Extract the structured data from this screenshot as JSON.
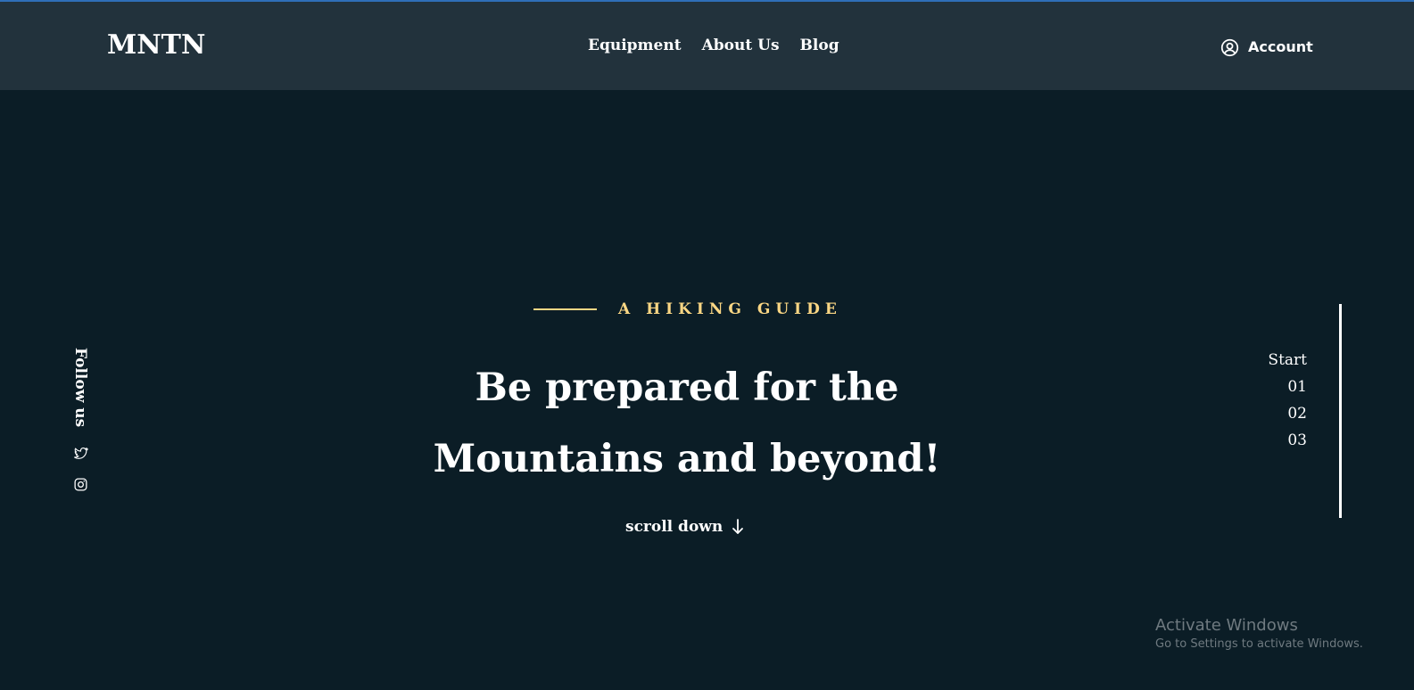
{
  "header": {
    "logo": "MNTN",
    "nav": [
      {
        "label": "Equipment"
      },
      {
        "label": "About Us"
      },
      {
        "label": "Blog"
      }
    ],
    "account_label": "Account",
    "account_icon": "user-circle-icon"
  },
  "sidebar": {
    "follow_label": "Follow us",
    "socials": [
      {
        "icon": "twitter-icon"
      },
      {
        "icon": "instagram-icon"
      }
    ]
  },
  "hero": {
    "eyebrow": "A HIKING GUIDE",
    "headline_line1": "Be prepared for the",
    "headline_line2": "Mountains and beyond!",
    "scroll_label": "scroll down",
    "scroll_icon": "arrow-down-icon"
  },
  "pager": {
    "items": [
      "Start",
      "01",
      "02",
      "03"
    ]
  },
  "watermark": {
    "title": "Activate Windows",
    "subtitle": "Go to Settings to activate Windows."
  },
  "colors": {
    "background": "#0b1d26",
    "header_bg": "#22323c",
    "accent": "#fbd784",
    "text": "#ffffff"
  }
}
